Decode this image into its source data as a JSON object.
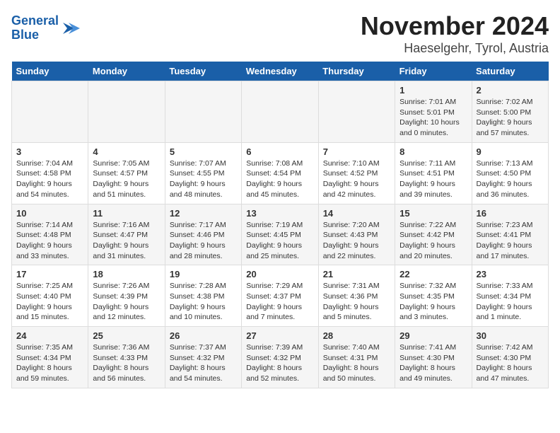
{
  "logo": {
    "line1": "General",
    "line2": "Blue"
  },
  "title": "November 2024",
  "subtitle": "Haeselgehr, Tyrol, Austria",
  "weekdays": [
    "Sunday",
    "Monday",
    "Tuesday",
    "Wednesday",
    "Thursday",
    "Friday",
    "Saturday"
  ],
  "weeks": [
    [
      {
        "day": "",
        "info": ""
      },
      {
        "day": "",
        "info": ""
      },
      {
        "day": "",
        "info": ""
      },
      {
        "day": "",
        "info": ""
      },
      {
        "day": "",
        "info": ""
      },
      {
        "day": "1",
        "info": "Sunrise: 7:01 AM\nSunset: 5:01 PM\nDaylight: 10 hours\nand 0 minutes."
      },
      {
        "day": "2",
        "info": "Sunrise: 7:02 AM\nSunset: 5:00 PM\nDaylight: 9 hours\nand 57 minutes."
      }
    ],
    [
      {
        "day": "3",
        "info": "Sunrise: 7:04 AM\nSunset: 4:58 PM\nDaylight: 9 hours\nand 54 minutes."
      },
      {
        "day": "4",
        "info": "Sunrise: 7:05 AM\nSunset: 4:57 PM\nDaylight: 9 hours\nand 51 minutes."
      },
      {
        "day": "5",
        "info": "Sunrise: 7:07 AM\nSunset: 4:55 PM\nDaylight: 9 hours\nand 48 minutes."
      },
      {
        "day": "6",
        "info": "Sunrise: 7:08 AM\nSunset: 4:54 PM\nDaylight: 9 hours\nand 45 minutes."
      },
      {
        "day": "7",
        "info": "Sunrise: 7:10 AM\nSunset: 4:52 PM\nDaylight: 9 hours\nand 42 minutes."
      },
      {
        "day": "8",
        "info": "Sunrise: 7:11 AM\nSunset: 4:51 PM\nDaylight: 9 hours\nand 39 minutes."
      },
      {
        "day": "9",
        "info": "Sunrise: 7:13 AM\nSunset: 4:50 PM\nDaylight: 9 hours\nand 36 minutes."
      }
    ],
    [
      {
        "day": "10",
        "info": "Sunrise: 7:14 AM\nSunset: 4:48 PM\nDaylight: 9 hours\nand 33 minutes."
      },
      {
        "day": "11",
        "info": "Sunrise: 7:16 AM\nSunset: 4:47 PM\nDaylight: 9 hours\nand 31 minutes."
      },
      {
        "day": "12",
        "info": "Sunrise: 7:17 AM\nSunset: 4:46 PM\nDaylight: 9 hours\nand 28 minutes."
      },
      {
        "day": "13",
        "info": "Sunrise: 7:19 AM\nSunset: 4:45 PM\nDaylight: 9 hours\nand 25 minutes."
      },
      {
        "day": "14",
        "info": "Sunrise: 7:20 AM\nSunset: 4:43 PM\nDaylight: 9 hours\nand 22 minutes."
      },
      {
        "day": "15",
        "info": "Sunrise: 7:22 AM\nSunset: 4:42 PM\nDaylight: 9 hours\nand 20 minutes."
      },
      {
        "day": "16",
        "info": "Sunrise: 7:23 AM\nSunset: 4:41 PM\nDaylight: 9 hours\nand 17 minutes."
      }
    ],
    [
      {
        "day": "17",
        "info": "Sunrise: 7:25 AM\nSunset: 4:40 PM\nDaylight: 9 hours\nand 15 minutes."
      },
      {
        "day": "18",
        "info": "Sunrise: 7:26 AM\nSunset: 4:39 PM\nDaylight: 9 hours\nand 12 minutes."
      },
      {
        "day": "19",
        "info": "Sunrise: 7:28 AM\nSunset: 4:38 PM\nDaylight: 9 hours\nand 10 minutes."
      },
      {
        "day": "20",
        "info": "Sunrise: 7:29 AM\nSunset: 4:37 PM\nDaylight: 9 hours\nand 7 minutes."
      },
      {
        "day": "21",
        "info": "Sunrise: 7:31 AM\nSunset: 4:36 PM\nDaylight: 9 hours\nand 5 minutes."
      },
      {
        "day": "22",
        "info": "Sunrise: 7:32 AM\nSunset: 4:35 PM\nDaylight: 9 hours\nand 3 minutes."
      },
      {
        "day": "23",
        "info": "Sunrise: 7:33 AM\nSunset: 4:34 PM\nDaylight: 9 hours\nand 1 minute."
      }
    ],
    [
      {
        "day": "24",
        "info": "Sunrise: 7:35 AM\nSunset: 4:34 PM\nDaylight: 8 hours\nand 59 minutes."
      },
      {
        "day": "25",
        "info": "Sunrise: 7:36 AM\nSunset: 4:33 PM\nDaylight: 8 hours\nand 56 minutes."
      },
      {
        "day": "26",
        "info": "Sunrise: 7:37 AM\nSunset: 4:32 PM\nDaylight: 8 hours\nand 54 minutes."
      },
      {
        "day": "27",
        "info": "Sunrise: 7:39 AM\nSunset: 4:32 PM\nDaylight: 8 hours\nand 52 minutes."
      },
      {
        "day": "28",
        "info": "Sunrise: 7:40 AM\nSunset: 4:31 PM\nDaylight: 8 hours\nand 50 minutes."
      },
      {
        "day": "29",
        "info": "Sunrise: 7:41 AM\nSunset: 4:30 PM\nDaylight: 8 hours\nand 49 minutes."
      },
      {
        "day": "30",
        "info": "Sunrise: 7:42 AM\nSunset: 4:30 PM\nDaylight: 8 hours\nand 47 minutes."
      }
    ]
  ]
}
